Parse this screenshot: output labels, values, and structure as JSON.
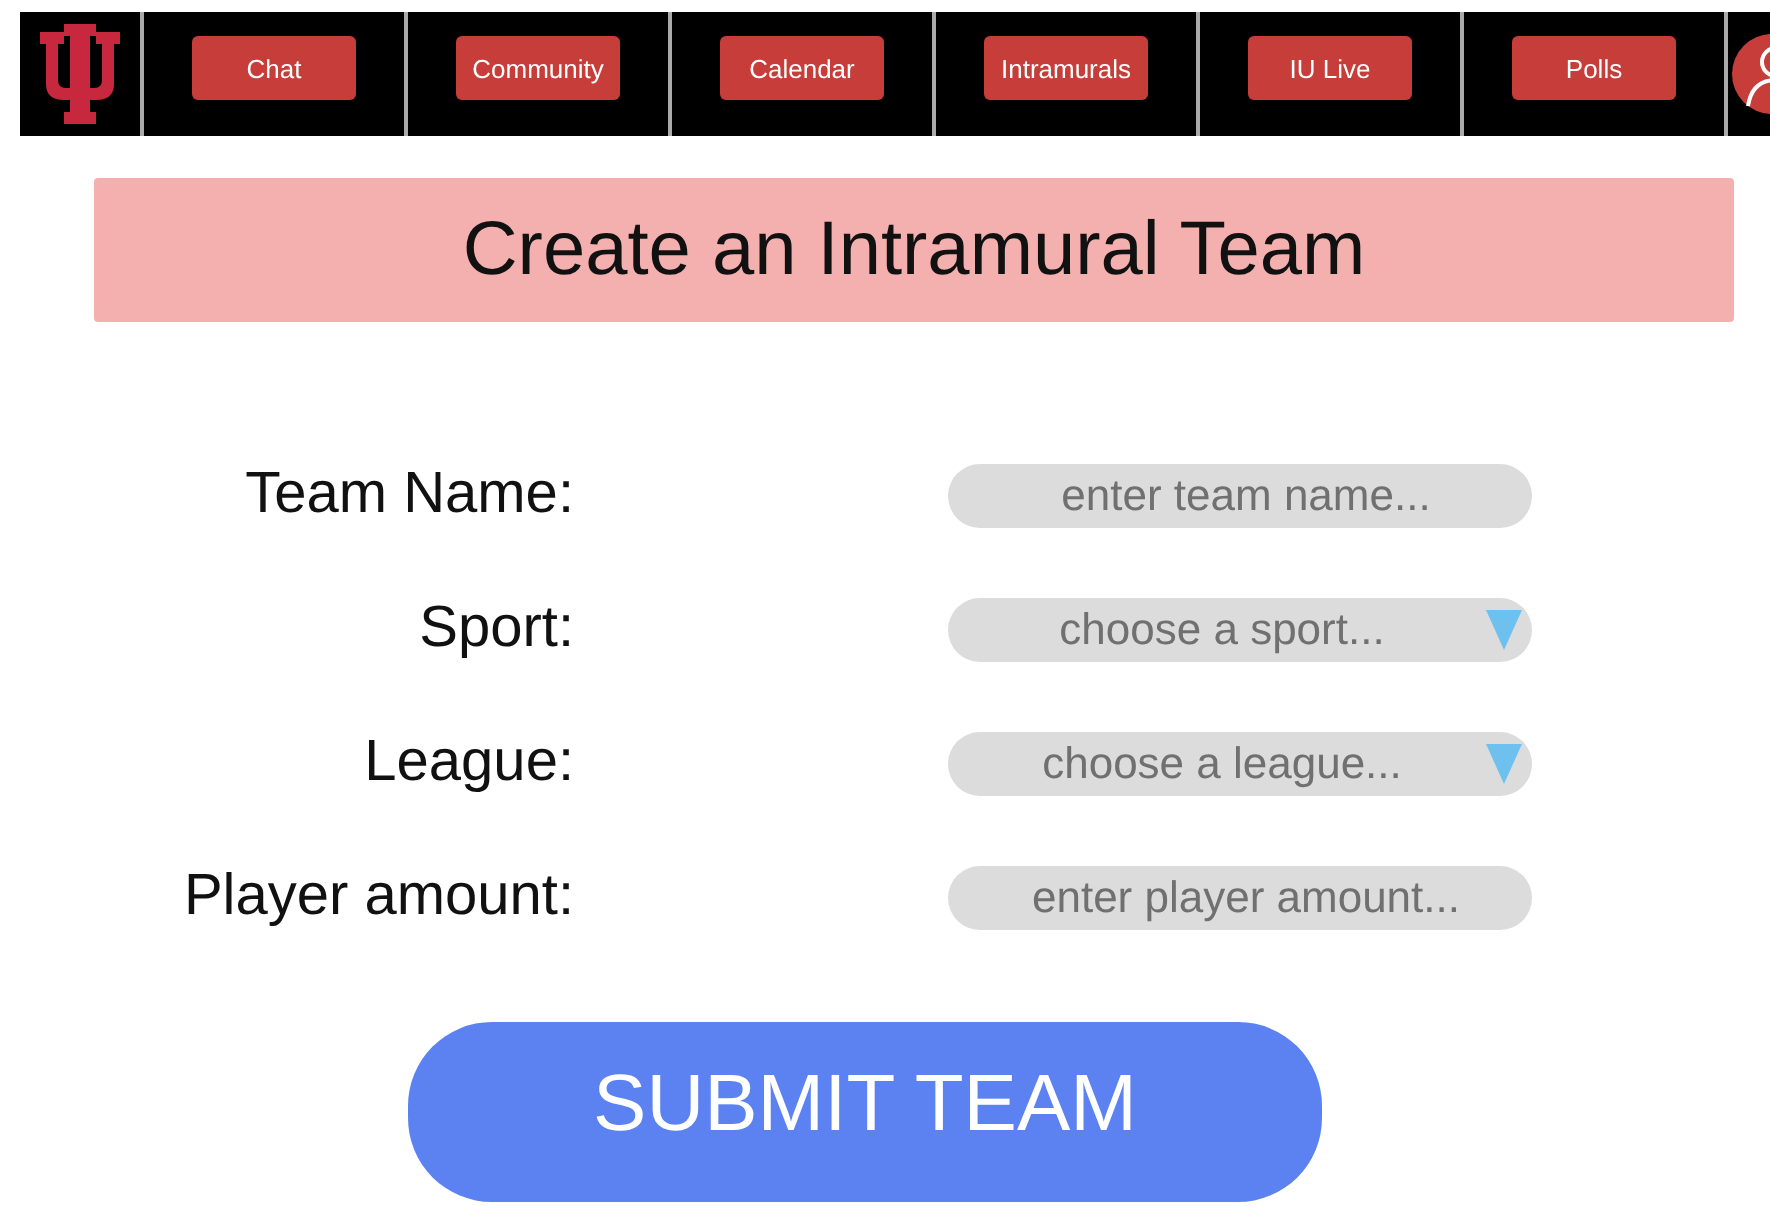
{
  "nav": {
    "items": [
      {
        "label": "Chat"
      },
      {
        "label": "Community"
      },
      {
        "label": "Calendar"
      },
      {
        "label": "Intramurals"
      },
      {
        "label": "IU Live"
      },
      {
        "label": "Polls"
      }
    ]
  },
  "title": "Create an Intramural Team",
  "form": {
    "fields": [
      {
        "label": "Team Name:",
        "kind": "text",
        "placeholder": "enter team name..."
      },
      {
        "label": "Sport:",
        "kind": "select",
        "placeholder": "choose a sport..."
      },
      {
        "label": "League:",
        "kind": "select",
        "placeholder": "choose a league..."
      },
      {
        "label": "Player amount:",
        "kind": "text",
        "placeholder": "enter player amount..."
      }
    ]
  },
  "submit": "SUBMIT TEAM"
}
